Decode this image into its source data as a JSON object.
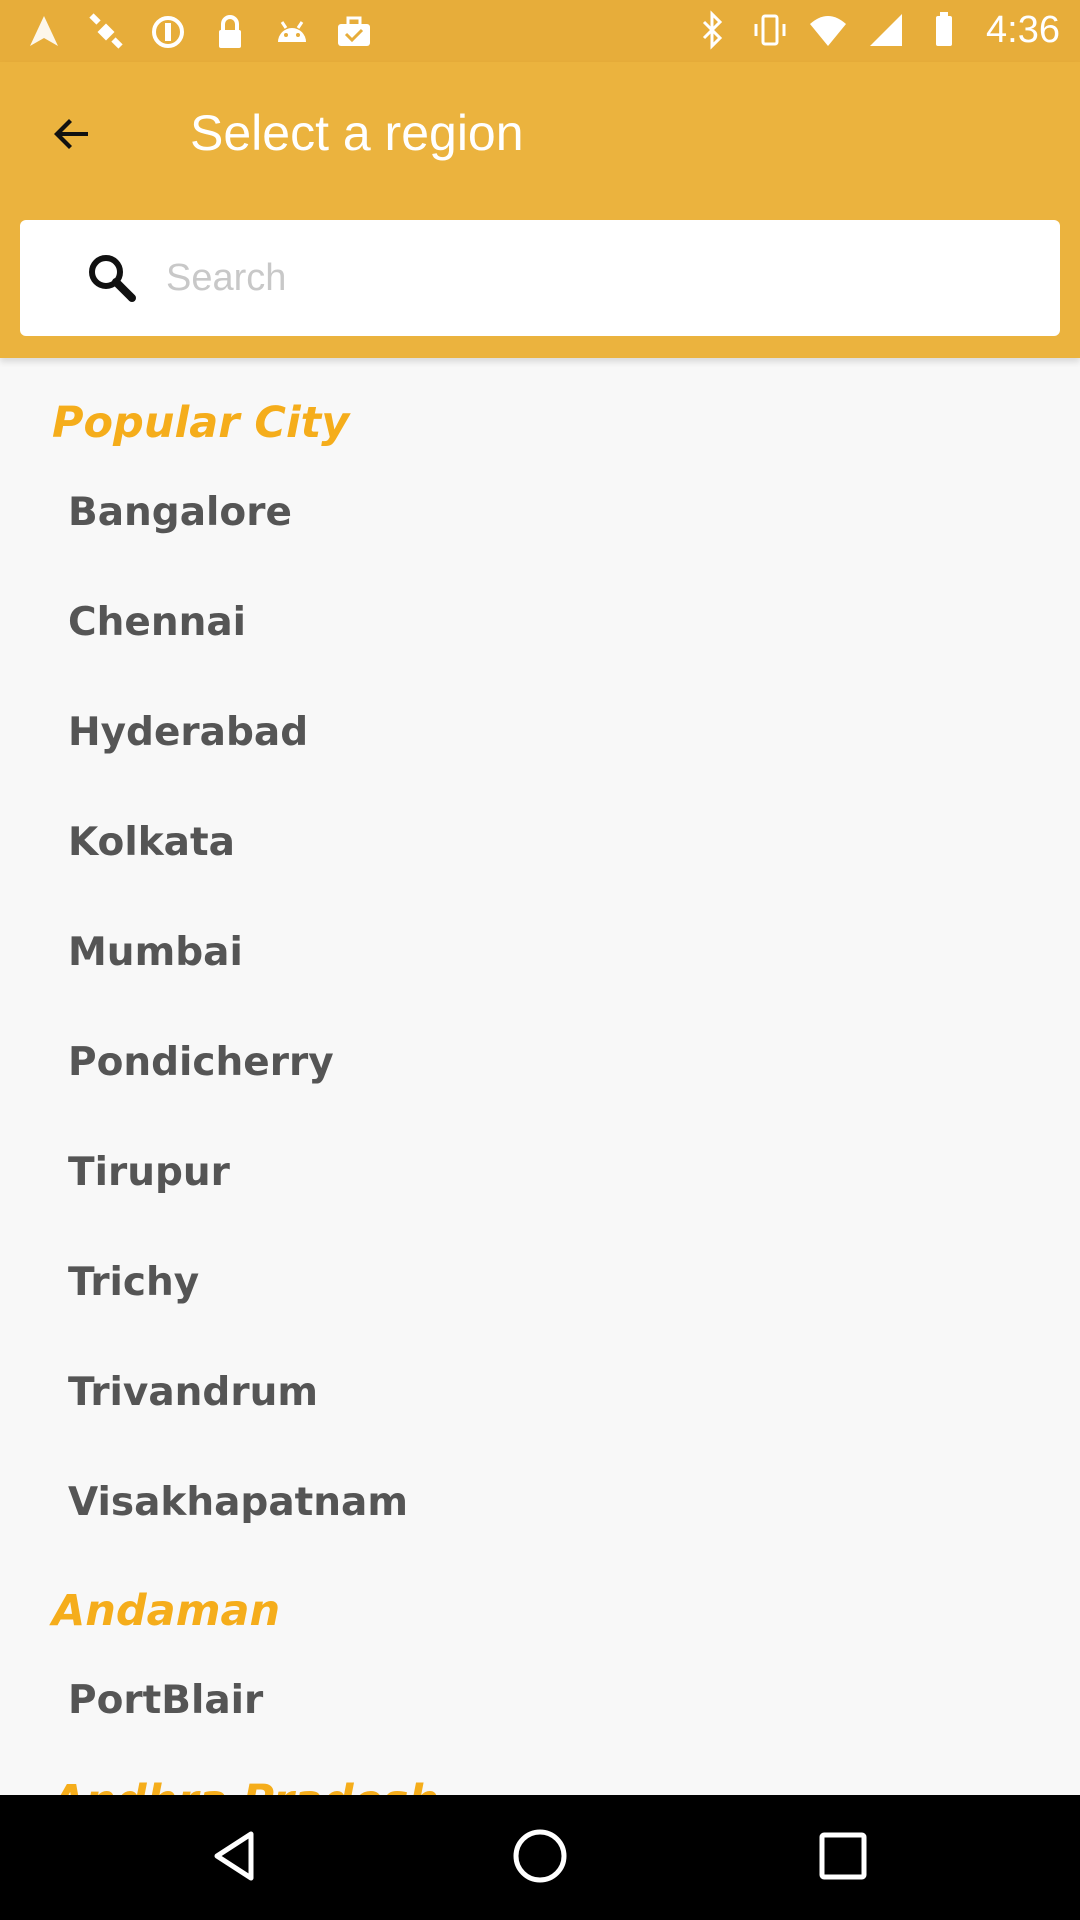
{
  "status_bar": {
    "time": "4:36",
    "left_icons": [
      "fake-gps-icon",
      "satellite-icon",
      "sync-icon",
      "lock-icon",
      "android-icon",
      "briefcase-check-icon"
    ],
    "right_icons": [
      "bluetooth-icon",
      "vibrate-icon",
      "wifi-icon",
      "signal-icon",
      "battery-icon"
    ]
  },
  "app_bar": {
    "title": "Select a region",
    "back_icon": "arrow-back-icon"
  },
  "search": {
    "placeholder": "Search",
    "value": ""
  },
  "sections": [
    {
      "title": "Popular City",
      "items": [
        "Bangalore",
        "Chennai",
        "Hyderabad",
        "Kolkata",
        "Mumbai",
        "Pondicherry",
        "Tirupur",
        "Trichy",
        "Trivandrum",
        "Visakhapatnam"
      ]
    },
    {
      "title": "Andaman",
      "items": [
        "PortBlair"
      ]
    },
    {
      "title": "Andhra Pradesh",
      "items": []
    }
  ],
  "nav_bar": {
    "buttons": [
      "back-triangle-icon",
      "home-circle-icon",
      "recents-square-icon"
    ]
  },
  "colors": {
    "status_bar": "#e7ad3a",
    "app_bar": "#ebb33e",
    "section_header": "#f5ad1b",
    "item_text": "#555555",
    "background": "#f8f8f8"
  }
}
